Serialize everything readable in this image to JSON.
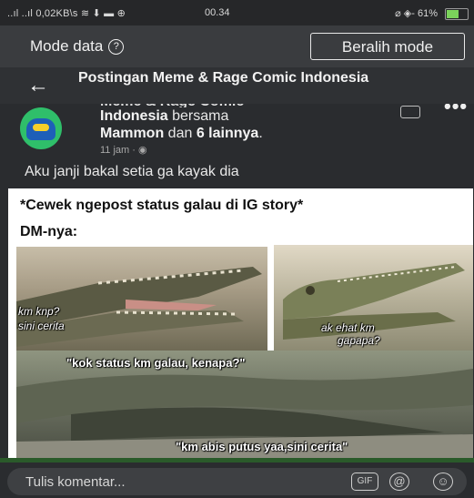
{
  "status_bar": {
    "left": "..ıl ..ıl 0,02KB\\s ≋ ⬇ ▬ ⊕",
    "time": "00.34",
    "right": "⌀ ◈- 61%",
    "battery_level": 0.61
  },
  "mode_bar": {
    "label": "Mode data",
    "help_icon": "?",
    "switch_button": "Beralih mode"
  },
  "header": {
    "back_icon": "←",
    "title": "Postingan Meme & Rage Comic Indonesia"
  },
  "post": {
    "page_name_cut": "Meme & Rage Comic",
    "page_name": "Indonesia",
    "with_text": " bersama",
    "tagged_1": "Mammon",
    "and_text": " dan ",
    "tagged_count": "6 lainnya",
    "period": ".",
    "time": "11 jam · ◉",
    "more_icon": "•••",
    "caption": "Aku janji bakal setia ga kayak dia"
  },
  "meme": {
    "title": "*Cewek ngepost status galau di IG story*",
    "subtitle": "DM-nya:",
    "caption_1": "km knp?",
    "caption_2": "sini cerita",
    "caption_3": "ak ehat km",
    "caption_4": "gapapa?",
    "caption_5": "\"kok status km galau, kenapa?\"",
    "caption_6": "\"km abis putus yaa,sini cerita\""
  },
  "footer": {
    "placeholder": "Tulis komentar...",
    "gif_label": "GIF",
    "at_label": "@",
    "smile_label": "☺"
  },
  "colors": {
    "background": "#2a2c2f",
    "mode_bar": "#3a3c3f",
    "avatar_green": "#2fbf6a",
    "battery": "#7bd35b"
  }
}
